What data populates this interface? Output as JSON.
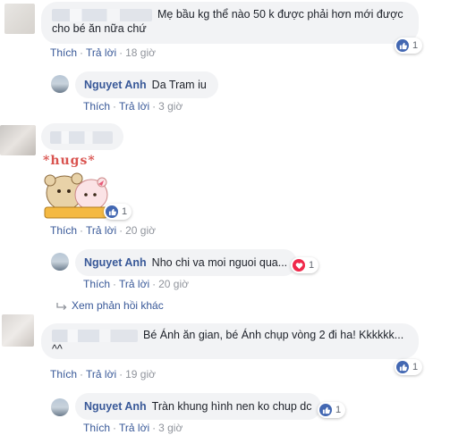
{
  "comments": [
    {
      "text_line1": "Mẹ bầu kg thể nào 50 k được phải hơn mới được",
      "text_line2": "cho bé ăn nữa chứ",
      "actions": {
        "like": "Thích",
        "reply": "Trả lời",
        "time": "18 giờ"
      },
      "reactions": {
        "count": "1",
        "type": "like"
      }
    },
    {
      "author": "Nguyet Anh",
      "text": "Da Tram iu",
      "actions": {
        "like": "Thích",
        "reply": "Trả lời",
        "time": "3 giờ"
      }
    },
    {
      "sticker_caption": "*hugs*",
      "actions": {
        "like": "Thích",
        "reply": "Trả lời",
        "time": "20 giờ"
      },
      "reactions": {
        "count": "1",
        "type": "like"
      }
    },
    {
      "author": "Nguyet Anh",
      "text": "Nho chi va moi nguoi qua...",
      "actions": {
        "like": "Thích",
        "reply": "Trả lời",
        "time": "20 giờ"
      },
      "reactions": {
        "count": "1",
        "type": "heart"
      }
    },
    {
      "more_replies": "Xem phản hồi khác"
    },
    {
      "text_line1": "Bé Ánh ăn gian, bé Ánh chụp vòng 2 đi ha! Kkkkkk...",
      "text_line2": "^^",
      "actions": {
        "like": "Thích",
        "reply": "Trả lời",
        "time": "19 giờ"
      },
      "reactions": {
        "count": "1",
        "type": "like"
      }
    },
    {
      "author": "Nguyet Anh",
      "text": "Tràn khung hình nen ko chup dc",
      "actions": {
        "like": "Thích",
        "reply": "Trả lời",
        "time": "3 giờ"
      },
      "reactions": {
        "count": "1",
        "type": "like"
      }
    }
  ],
  "colors": {
    "link": "#385898",
    "bubble": "#f2f3f5",
    "like": "#4267b2",
    "heart": "#f0284a"
  },
  "icons": {
    "like": "thumbs-up-icon",
    "heart": "heart-icon",
    "reply_arrow": "reply-arrow-icon"
  }
}
